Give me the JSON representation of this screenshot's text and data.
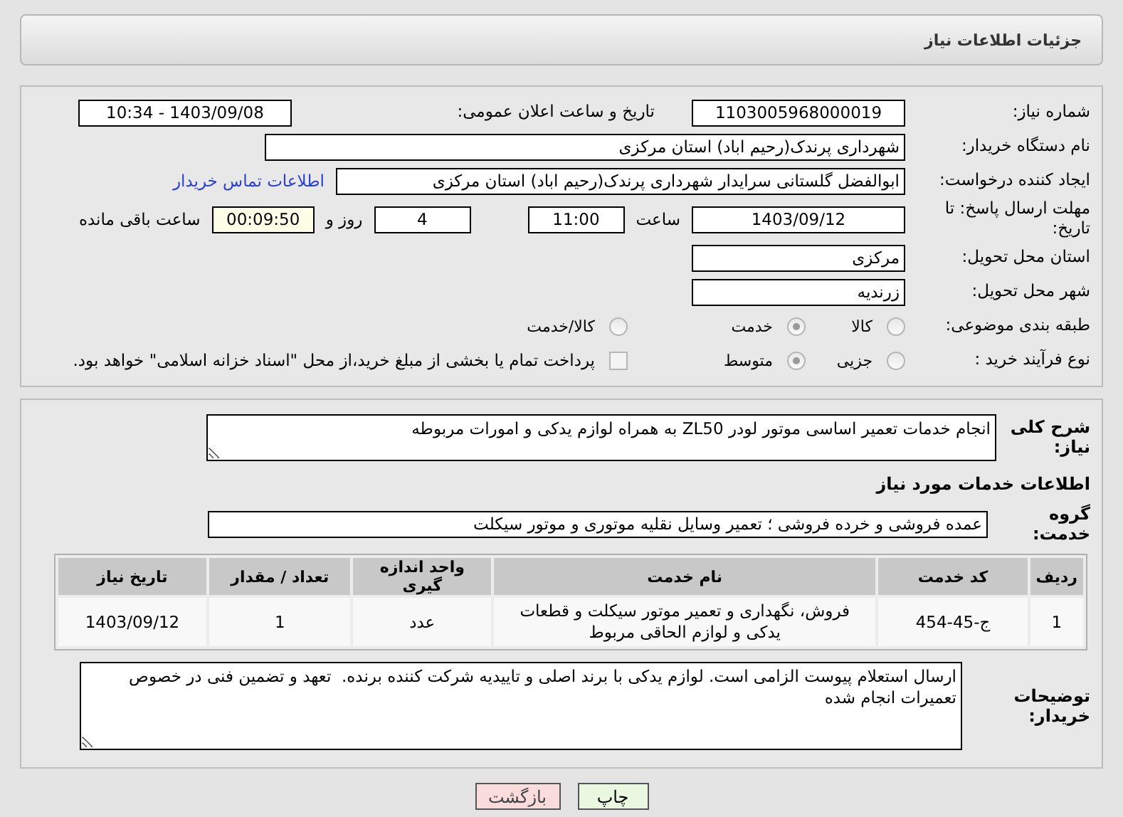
{
  "header": {
    "title": "جزئیات اطلاعات نیاز"
  },
  "need_number": {
    "label": "شماره نیاز:",
    "value": "1103005968000019"
  },
  "announce_date": {
    "label": "تاریخ و ساعت اعلان عمومی:",
    "value": "1403/09/08 - 10:34"
  },
  "buyer_org": {
    "label": "نام دستگاه خریدار:",
    "value": "شهرداری پرندک(رحیم اباد) استان مرکزی"
  },
  "requester": {
    "label": "ایجاد کننده درخواست:",
    "value": "ابوالفضل گلستانی سرایدار شهرداری پرندک(رحیم اباد) استان مرکزی",
    "link": "اطلاعات تماس خریدار"
  },
  "deadline": {
    "label": "مهلت ارسال پاسخ: تا تاریخ:",
    "date": "1403/09/12",
    "time_label": "ساعت",
    "time": "11:00",
    "days": "4",
    "days_label": "روز و",
    "remaining": "00:09:50",
    "remaining_label": "ساعت باقی مانده"
  },
  "province": {
    "label": "استان محل تحویل:",
    "value": "مرکزی"
  },
  "city": {
    "label": "شهر محل تحویل:",
    "value": "زرندیه"
  },
  "category": {
    "label": "طبقه بندی موضوعی:",
    "options": [
      {
        "label": "کالا",
        "selected": false
      },
      {
        "label": "خدمت",
        "selected": true
      },
      {
        "label": "کالا/خدمت",
        "selected": false
      }
    ]
  },
  "process": {
    "label": "نوع فرآیند خرید :",
    "options": [
      {
        "label": "جزیی",
        "selected": false
      },
      {
        "label": "متوسط",
        "selected": true
      }
    ],
    "payment": {
      "label": "پرداخت تمام یا بخشی از مبلغ خرید،از محل \"اسناد خزانه اسلامی\" خواهد بود.",
      "checked": false
    }
  },
  "description": {
    "label": "شرح کلی نیاز:",
    "value": "انجام خدمات تعمیر اساسی موتور لودر ZL50 به همراه لوازم یدکی و امورات مربوطه"
  },
  "services_title": "اطلاعات خدمات مورد نیاز",
  "service_group": {
    "label": "گروه خدمت:",
    "value": "عمده فروشی و خرده فروشی ؛ تعمیر وسایل نقلیه موتوری و موتور سیکلت"
  },
  "table": {
    "columns": [
      "ردیف",
      "کد خدمت",
      "نام خدمت",
      "واحد اندازه گیری",
      "تعداد / مقدار",
      "تاریخ نیاز"
    ],
    "rows": [
      [
        "1",
        "ج-45-454",
        "فروش، نگهداری و تعمیر موتور سیکلت و قطعات یدکی و لوازم الحاقی مربوط",
        "عدد",
        "1",
        "1403/09/12"
      ]
    ]
  },
  "buyer_notes": {
    "label": "توضیحات خریدار:",
    "value": "ارسال استعلام پیوست الزامی است. لوازم یدکی با برند اصلی و تاییدیه شرکت کننده برنده.  تعهد و تضمین فنی در خصوص تعمیرات انجام شده"
  },
  "buttons": [
    {
      "label": "چاپ",
      "kind": "print"
    },
    {
      "label": "بازگشت",
      "kind": "back"
    }
  ]
}
